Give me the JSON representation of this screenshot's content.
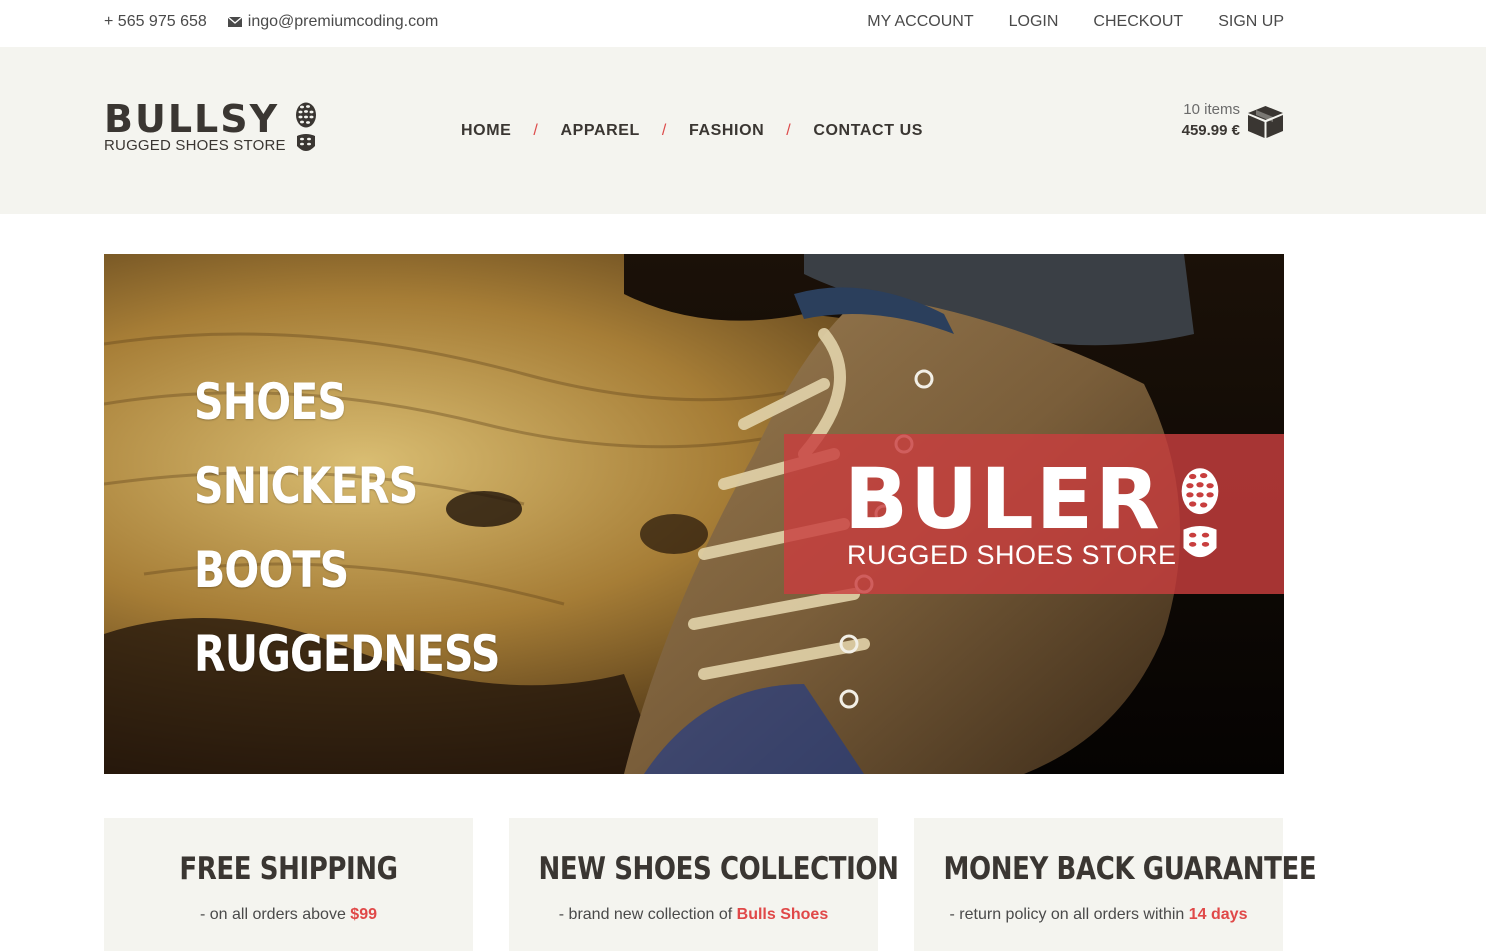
{
  "topbar": {
    "phone": "+ 565 975 658",
    "email": "ingo@premiumcoding.com",
    "email_icon": "mail-icon",
    "account_menu": [
      "MY ACCOUNT",
      "LOGIN",
      "CHECKOUT",
      "SIGN UP"
    ]
  },
  "header": {
    "logo": {
      "word": "BULLSY",
      "tagline": "RUGGED SHOES STORE",
      "icon": "shoe-print-icon"
    },
    "nav": [
      "HOME",
      "APPAREL",
      "FASHION",
      "CONTACT US"
    ],
    "nav_separator": "/",
    "cart": {
      "count": "10 items",
      "total": "459.99 €",
      "icon": "box-icon"
    }
  },
  "hero": {
    "list": [
      "SHOES",
      "SNICKERS",
      "BOOTS",
      "RUGGEDNESS"
    ],
    "banner": {
      "word": "BULER",
      "tagline": "RUGGED SHOES STORE",
      "icon": "shoe-print-icon"
    }
  },
  "features": [
    {
      "title": "FREE SHIPPING",
      "text": "- on all orders above ",
      "highlight": "$99"
    },
    {
      "title": "NEW SHOES COLLECTION",
      "text": "- brand new collection of ",
      "highlight": "Bulls Shoes"
    },
    {
      "title": "MONEY BACK GUARANTEE",
      "text": "- return policy on all orders within ",
      "highlight": "14 days"
    }
  ],
  "colors": {
    "accent": "#e04848",
    "header_bg": "#f4f4ef",
    "text_dark": "#3a3632",
    "banner_red": "#c83e3e"
  }
}
